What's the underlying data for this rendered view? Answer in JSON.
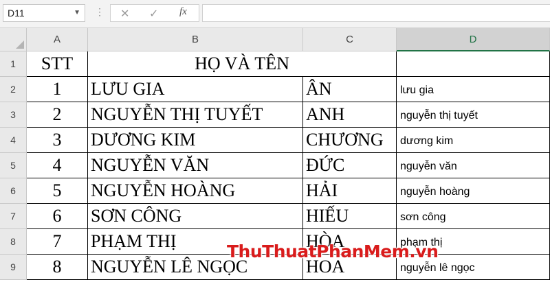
{
  "formula_bar": {
    "name_box": "D11",
    "dots": "⋮",
    "cancel": "✕",
    "enter": "✓",
    "fx": "fx",
    "content": ""
  },
  "columns": [
    "A",
    "B",
    "C",
    "D"
  ],
  "rows": [
    {
      "num": "1",
      "a": "STT",
      "b": "HỌ VÀ TÊN",
      "c": "",
      "d": ""
    },
    {
      "num": "2",
      "a": "1",
      "b": "LƯU GIA",
      "c": "ÂN",
      "d": "lưu gia"
    },
    {
      "num": "3",
      "a": "2",
      "b": "NGUYỄN THỊ TUYẾT",
      "c": "ANH",
      "d": "nguyễn thị tuyết"
    },
    {
      "num": "4",
      "a": "3",
      "b": "DƯƠNG KIM",
      "c": "CHƯƠNG",
      "d": "dương kim"
    },
    {
      "num": "5",
      "a": "4",
      "b": "NGUYỄN VĂN",
      "c": "ĐỨC",
      "d": "nguyễn văn"
    },
    {
      "num": "6",
      "a": "5",
      "b": "NGUYỄN HOÀNG",
      "c": "HẢI",
      "d": "nguyễn hoàng"
    },
    {
      "num": "7",
      "a": "6",
      "b": "SƠN CÔNG",
      "c": "HIẾU",
      "d": "sơn công"
    },
    {
      "num": "8",
      "a": "7",
      "b": "PHẠM THỊ",
      "c": "HÒA",
      "d": "phạm thị"
    },
    {
      "num": "9",
      "a": "8",
      "b": "NGUYỄN LÊ NGỌC",
      "c": "HOA",
      "d": "nguyễn lê ngọc"
    }
  ],
  "watermark": "ThuThuatPhanMem.vn",
  "colors": {
    "accent": "#217346",
    "watermark": "#d91c1c"
  }
}
